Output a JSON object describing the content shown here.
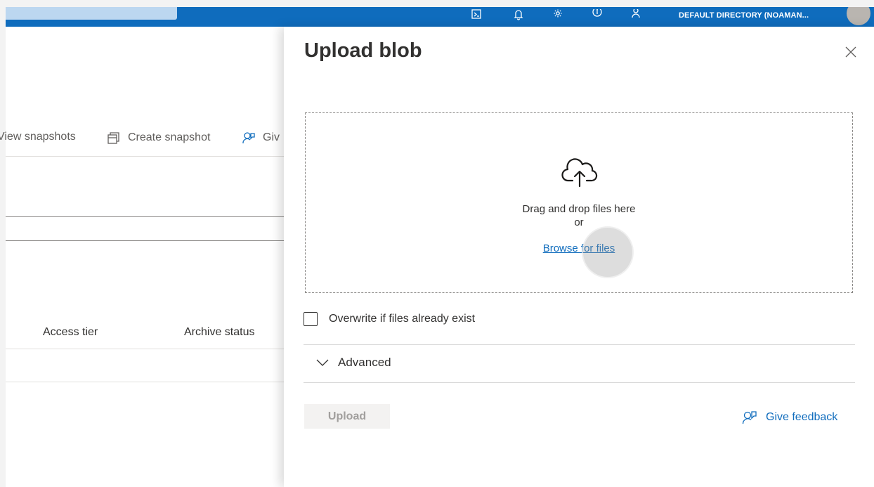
{
  "topbar": {
    "directory": "DEFAULT DIRECTORY (NOAMAN...",
    "icons": [
      "cloud-shell-icon",
      "bell-icon",
      "gear-icon",
      "help-icon",
      "feedback-icon"
    ],
    "accent": "#0f6cbd"
  },
  "toolbar": {
    "view_snapshots": "View snapshots",
    "create_snapshot": "Create snapshot",
    "give_feedback": "Giv"
  },
  "table": {
    "columns": [
      "Access tier",
      "Archive status"
    ]
  },
  "panel": {
    "title": "Upload blob",
    "dropzone": {
      "line1": "Drag and drop files here",
      "line2": "or",
      "browse": "Browse for files"
    },
    "overwrite_label": "Overwrite if files already exist",
    "overwrite_checked": false,
    "advanced_label": "Advanced",
    "upload_label": "Upload",
    "feedback_label": "Give feedback"
  }
}
